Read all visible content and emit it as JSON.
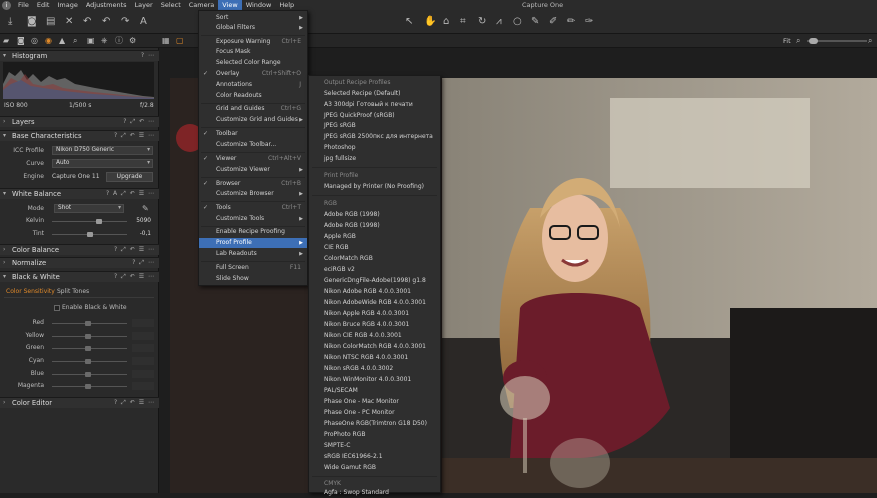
{
  "app": {
    "title": "Capture One",
    "menus": [
      "File",
      "Edit",
      "Image",
      "Adjustments",
      "Layer",
      "Select",
      "Camera",
      "View",
      "Window",
      "Help"
    ],
    "active_menu": "View"
  },
  "viewer": {
    "fit_label": "Fit"
  },
  "panels": {
    "histogram": {
      "title": "Histogram",
      "iso": "ISO 800",
      "shutter": "1/500 s",
      "aperture": "f/2.8"
    },
    "layers": {
      "title": "Layers"
    },
    "base_characteristics": {
      "title": "Base Characteristics",
      "icc_label": "ICC Profile",
      "icc_value": "Nikon D750 Generic",
      "curve_label": "Curve",
      "curve_value": "Auto",
      "engine_label": "Engine",
      "engine_value": "Capture One 11",
      "upgrade_button": "Upgrade"
    },
    "white_balance": {
      "title": "White Balance",
      "mode_label": "Mode",
      "mode_value": "Shot",
      "kelvin_label": "Kelvin",
      "kelvin_value": "5090",
      "kelvin_level": 0.62,
      "tint_label": "Tint",
      "tint_value": "-0,1",
      "tint_level": 0.5
    },
    "color_balance": {
      "title": "Color Balance"
    },
    "normalize": {
      "title": "Normalize"
    },
    "black_white": {
      "title": "Black & White",
      "tab_active": "Color Sensitivity",
      "tab_other": "Split Tones",
      "enable_label": "Enable Black & White",
      "sliders": [
        "Red",
        "Yellow",
        "Green",
        "Cyan",
        "Blue",
        "Magenta"
      ]
    },
    "color_editor": {
      "title": "Color Editor"
    }
  },
  "view_menu": {
    "items": [
      {
        "label": "Sort",
        "sub": true
      },
      {
        "label": "Global Filters",
        "sub": true
      },
      {
        "label": "Exposure Warning",
        "shortcut": "Ctrl+E"
      },
      {
        "label": "Focus Mask"
      },
      {
        "label": "Selected Color Range"
      },
      {
        "label": "Overlay",
        "shortcut": "Ctrl+Shift+O",
        "checked": true
      },
      {
        "label": "Annotations",
        "shortcut": "J"
      },
      {
        "label": "Color Readouts"
      },
      {
        "label": "Grid and Guides",
        "shortcut": "Ctrl+G"
      },
      {
        "label": "Customize Grid and Guides",
        "sub": true
      },
      {
        "label": "Toolbar",
        "checked": true
      },
      {
        "label": "Customize Toolbar..."
      },
      {
        "label": "Viewer",
        "shortcut": "Ctrl+Alt+V",
        "checked": true
      },
      {
        "label": "Customize Viewer",
        "sub": true
      },
      {
        "label": "Browser",
        "shortcut": "Ctrl+B",
        "checked": true
      },
      {
        "label": "Customize Browser",
        "sub": true
      },
      {
        "label": "Tools",
        "shortcut": "Ctrl+T",
        "checked": true
      },
      {
        "label": "Customize Tools",
        "sub": true
      },
      {
        "label": "Enable Recipe Proofing"
      },
      {
        "label": "Proof Profile",
        "sub": true,
        "highlighted": true
      },
      {
        "label": "Lab Readouts",
        "sub": true
      },
      {
        "label": "Full Screen",
        "shortcut": "F11"
      },
      {
        "label": "Slide Show"
      }
    ]
  },
  "proof_profile_menu": {
    "output_header": "Output Recipe Profiles",
    "output_items": [
      "Selected Recipe (Default)",
      "A3 300dpi Готовый к печати",
      "JPEG QuickProof (sRGB)",
      "JPEG sRGB",
      "JPEG sRGB 2500пкс для интернета",
      "Photoshop",
      "jpg fullsize"
    ],
    "print_header": "Print Profile",
    "print_items": [
      "Managed by Printer (No Proofing)"
    ],
    "rgb_header": "RGB",
    "rgb_items": [
      "Adobe RGB (1998)",
      "Adobe RGB (1998)",
      "Apple RGB",
      "CIE RGB",
      "ColorMatch RGB",
      "eciRGB v2",
      "GenericDngFile-Adobe(1998) g1.8",
      "Nikon Adobe RGB 4.0.0.3001",
      "Nikon AdobeWide RGB 4.0.0.3001",
      "Nikon Apple RGB 4.0.0.3001",
      "Nikon Bruce RGB 4.0.0.3001",
      "Nikon CIE RGB 4.0.0.3001",
      "Nikon ColorMatch RGB 4.0.0.3001",
      "Nikon NTSC RGB 4.0.0.3001",
      "Nikon sRGB 4.0.0.3002",
      "Nikon WinMonitor 4.0.0.3001",
      "PAL/SECAM",
      "Phase One - Mac Monitor",
      "Phase One - PC Monitor",
      "PhaseOne RGB(Trimtron G18 D50)",
      "ProPhoto RGB",
      "SMPTE-C",
      "sRGB IEC61966-2.1",
      "Wide Gamut RGB"
    ],
    "cmyk_header": "CMYK",
    "cmyk_items": [
      "Agfa : Swop Standard"
    ]
  },
  "colors": {
    "accent": "#3d6fb6",
    "tool_active": "#e08a2a",
    "tab_active": "#e08a2a"
  }
}
